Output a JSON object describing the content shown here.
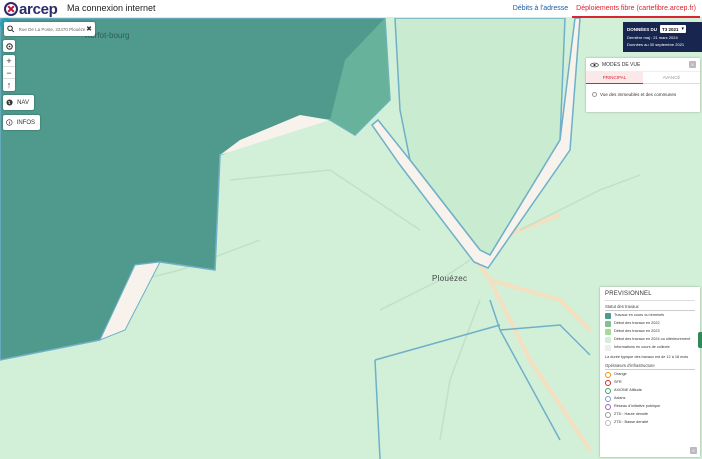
{
  "header": {
    "logo_text": "arcep",
    "site_title": "Ma connexion internet",
    "tabs": [
      {
        "label": "Débits à l'adresse",
        "active": false
      },
      {
        "label": "Déploiements fibre (cartefibre.arcep.fr)",
        "active": true
      }
    ]
  },
  "search": {
    "value": "Rue De La Poste, 22470 Plouézec",
    "clear_icon": "close-icon"
  },
  "map_controls": {
    "locate_icon": "target-icon",
    "zoom_in": "+",
    "zoom_out": "−",
    "compass": "↑",
    "nav_label": "NAV",
    "infos_label": "INFOS"
  },
  "map": {
    "town": "Plouézec",
    "partial_town": "Kerfot-bourg"
  },
  "data_panel": {
    "label": "DONNÉES DU",
    "selected": "T3 2021",
    "line1": "Dernière maj : 21 mars 2024",
    "line2": "Données au 30 septembre 2021"
  },
  "view_modes": {
    "title": "MODES DE VUE",
    "badge": "X",
    "tabs": [
      {
        "label": "PRINCIPAL",
        "active": true
      },
      {
        "label": "AVANCÉ",
        "active": false
      }
    ],
    "option": "Vue des immeubles et des communes"
  },
  "legend": {
    "title": "PREVISIONNEL",
    "status_title": "Statut des travaux",
    "status": [
      {
        "label": "Travaux en cours ou terminés",
        "color": "#4f9a8d"
      },
      {
        "label": "Début des travaux en 2022",
        "color": "#7ec48d"
      },
      {
        "label": "Début des travaux en 2023",
        "color": "#a9d99a"
      },
      {
        "label": "Début des travaux en 2024 ou ultérieurement",
        "color": "#d2efd8"
      },
      {
        "label": "Informations en cours de collecte",
        "color": "#eeeeee"
      }
    ],
    "note": "La durée typique des travaux est de 12 à 18 mois",
    "operators_title": "Opérateurs d'infrastructure",
    "operators": [
      {
        "label": "Orange",
        "color": "#f39200"
      },
      {
        "label": "SFR",
        "color": "#d9252f"
      },
      {
        "label": "AXIONE Altitude",
        "color": "#3aa65a"
      },
      {
        "label": "Axians",
        "color": "#7d9bd0"
      },
      {
        "label": "Réseau d'initiative publique",
        "color": "#a064b4"
      },
      {
        "label": "ZTD : Haute densité",
        "color": "#999999"
      },
      {
        "label": "ZTD : Basse densité",
        "color": "#bbbbbb"
      }
    ],
    "badge": "X"
  },
  "colors": {
    "dark_zone": "#4f9a8d",
    "light_zone": "#d2efd8",
    "border_zone": "#6fb0c8",
    "road": "#f5d9b5",
    "accent": "#d9252f"
  }
}
